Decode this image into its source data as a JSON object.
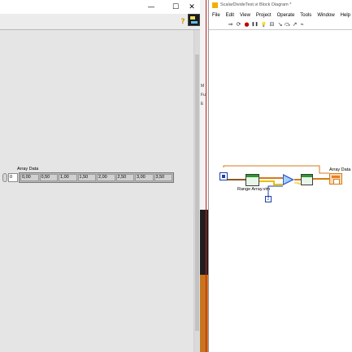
{
  "front_panel": {
    "window_controls": {
      "minimize": "—",
      "maximize": "☐",
      "close": "✕"
    },
    "help_glyph": "?",
    "array": {
      "label": "Array Data",
      "index": "0",
      "values": [
        "0,00",
        "0,50",
        "1,00",
        "1,50",
        "2,00",
        "2,50",
        "3,00",
        "3,50"
      ]
    }
  },
  "middle_window": {
    "fragments": [
      "M",
      "Fu",
      "E"
    ]
  },
  "block_diagram": {
    "title": "ScalarDivideTest.vi Block Diagram *",
    "menu": [
      "File",
      "Edit",
      "View",
      "Project",
      "Operate",
      "Tools",
      "Window",
      "Help"
    ],
    "toolbar_icons": [
      "run-arrow-icon",
      "continuous-run-icon",
      "abort-icon",
      "pause-icon",
      "highlight-execution-icon",
      "retain-wire-values-icon",
      "step-into-icon",
      "step-over-icon",
      "step-out-icon",
      "clean-up-icon"
    ],
    "toolbar_glyphs": [
      "⇒",
      "⟳",
      "●",
      "❚❚",
      "💡",
      "⊟",
      "↘",
      "⤼",
      "↗",
      "⌁"
    ],
    "nodes": {
      "range_array_label": "Range Array.vim",
      "const_value": "2",
      "num_value": "0",
      "indicator_label": "Array Data"
    }
  },
  "colors": {
    "panel_bg": "#e5e5e5",
    "wire_orange": "#d57a1a",
    "wire_blue": "#1e3ea8",
    "wire_brown": "#8a5a20"
  }
}
